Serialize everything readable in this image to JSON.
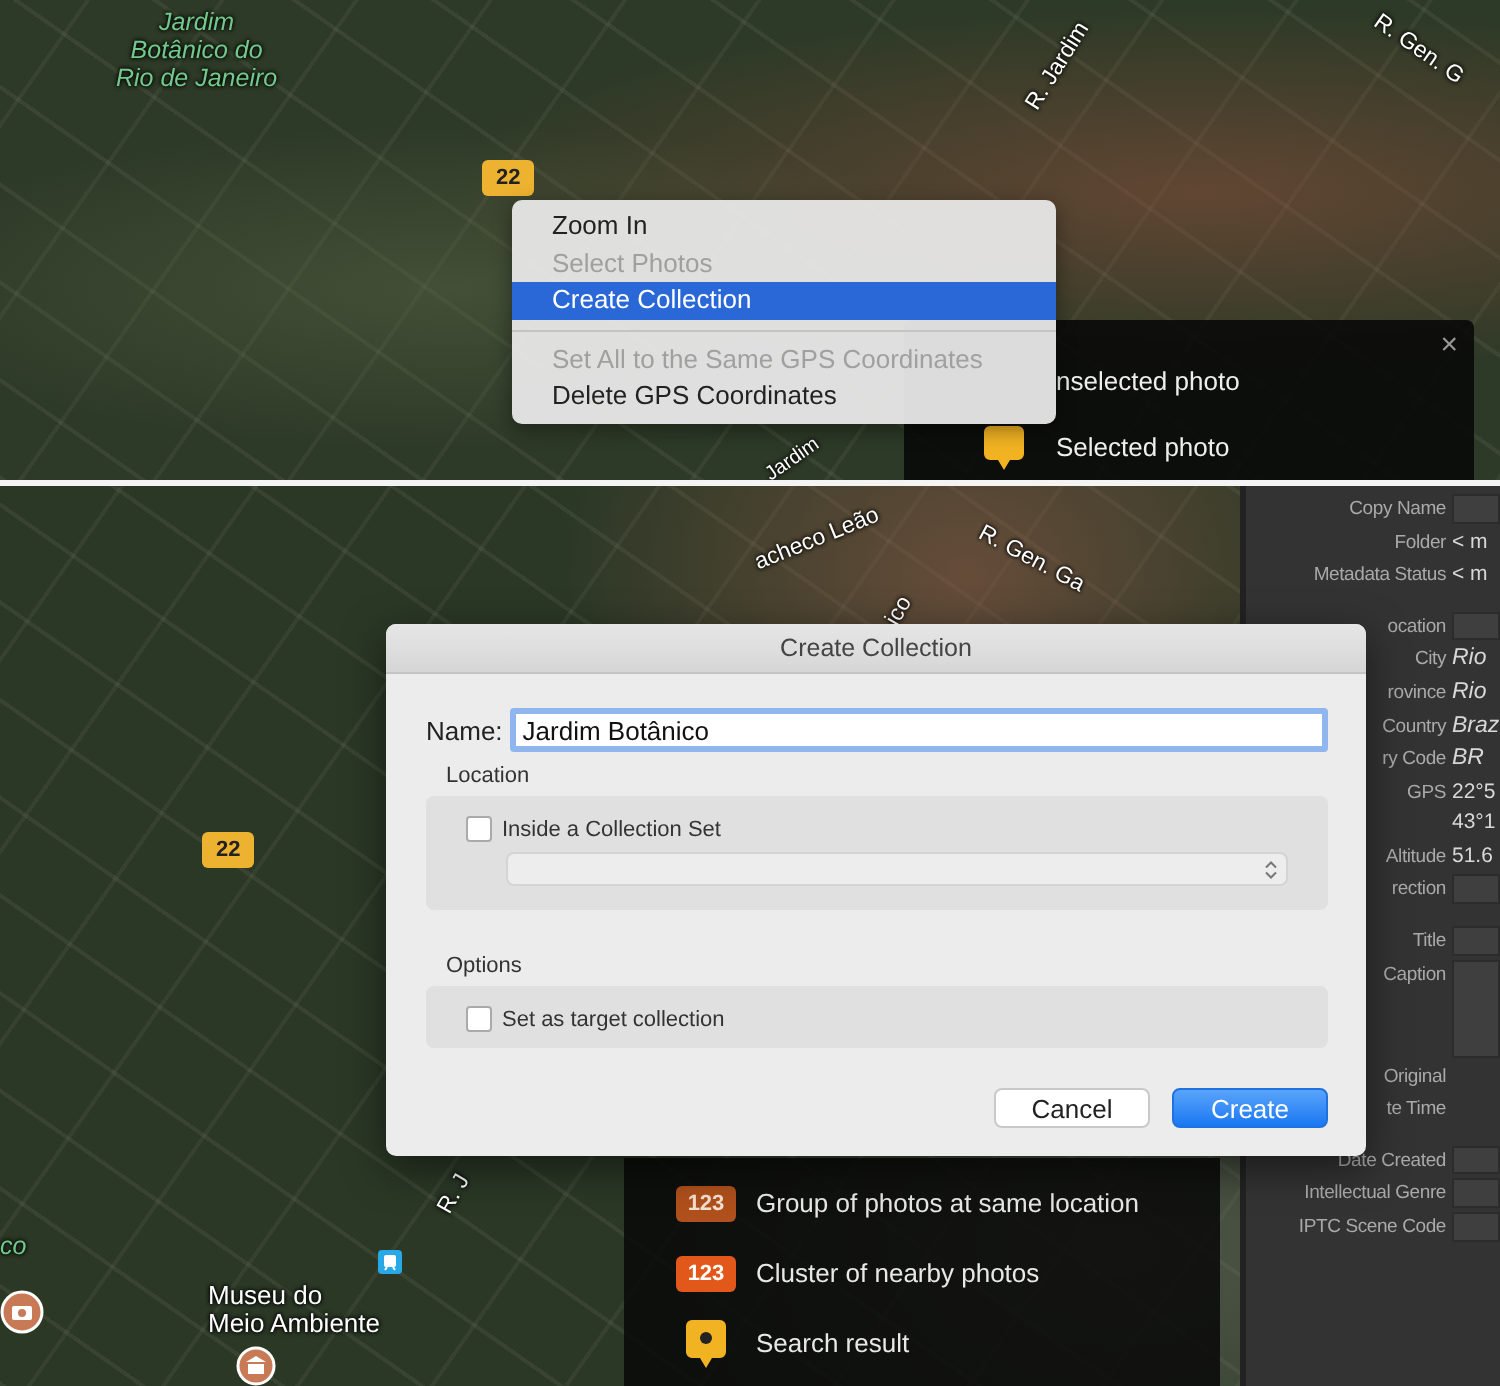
{
  "top_map": {
    "place_label": "Jardim\nBotânico do\nRio de Janeiro",
    "street_labels": [
      "R. Jardim",
      "R. Gen. G",
      "Jardim"
    ],
    "marker": "22"
  },
  "context_menu": {
    "items": [
      {
        "kind": "item",
        "label": "Zoom In",
        "disabled": false,
        "selected": false
      },
      {
        "kind": "item",
        "label": "Select Photos",
        "disabled": true,
        "selected": false
      },
      {
        "kind": "item",
        "label": "Create Collection",
        "disabled": false,
        "selected": true
      },
      {
        "kind": "separator"
      },
      {
        "kind": "item",
        "label": "Set All to the Same GPS Coordinates",
        "disabled": true,
        "selected": false
      },
      {
        "kind": "item",
        "label": "Delete GPS Coordinates",
        "disabled": false,
        "selected": false
      }
    ]
  },
  "top_legend": {
    "close": "×",
    "items": [
      {
        "kind": "covered",
        "label": "nselected photo"
      },
      {
        "kind": "selected",
        "label": "Selected photo"
      }
    ]
  },
  "bottom_map": {
    "street_labels": [
      "acheco Leão",
      "R. Gen. Ga",
      "ico",
      "R. J"
    ],
    "place_labels": [
      "co",
      "Museu do\nMeio Ambiente"
    ],
    "marker": "22"
  },
  "bottom_legend": {
    "items": [
      {
        "kind": "group",
        "badge": "123",
        "label": "Group of photos at same location"
      },
      {
        "kind": "cluster",
        "badge": "123",
        "label": "Cluster of nearby photos"
      },
      {
        "kind": "search",
        "label": "Search result"
      }
    ]
  },
  "metadata_panel": {
    "groups": [
      [
        {
          "label": "Copy Name",
          "kind": "field"
        },
        {
          "label": "Folder",
          "kind": "text",
          "value": "< m"
        },
        {
          "label": "Metadata Status",
          "kind": "text",
          "value": "< m"
        }
      ],
      [
        {
          "label": "ocation",
          "kind": "field"
        },
        {
          "label": "City",
          "kind": "italic",
          "value": "Rio"
        },
        {
          "label": "rovince",
          "kind": "italic",
          "value": "Rio"
        },
        {
          "label": "Country",
          "kind": "italic",
          "value": "Braz"
        },
        {
          "label": "ry Code",
          "kind": "italic",
          "value": "BR"
        },
        {
          "label": "GPS",
          "kind": "text",
          "value": "22°5\n43°1"
        },
        {
          "label": "Altitude",
          "kind": "text",
          "value": "51.6"
        },
        {
          "label": "rection",
          "kind": "field"
        }
      ],
      [
        {
          "label": "Title",
          "kind": "field"
        },
        {
          "label": "Caption",
          "kind": "tall-field"
        },
        {
          "label": "Original",
          "kind": "none"
        },
        {
          "label": "te Time",
          "kind": "none"
        }
      ],
      [
        {
          "label": "Date Created",
          "kind": "field"
        },
        {
          "label": "Intellectual Genre",
          "kind": "field"
        },
        {
          "label": "IPTC Scene Code",
          "kind": "field"
        }
      ]
    ]
  },
  "dialog": {
    "title": "Create Collection",
    "name_label": "Name:",
    "name_value": "Jardim Botânico",
    "sections": [
      {
        "kind": "with-popup",
        "title": "Location",
        "checkbox": {
          "label": "Inside a Collection Set",
          "checked": false
        }
      },
      {
        "kind": "plain",
        "title": "Options",
        "checkbox": {
          "label": "Set as target collection",
          "checked": false
        }
      }
    ],
    "buttons": [
      {
        "label": "Cancel",
        "default": false
      },
      {
        "label": "Create",
        "default": true
      }
    ]
  }
}
